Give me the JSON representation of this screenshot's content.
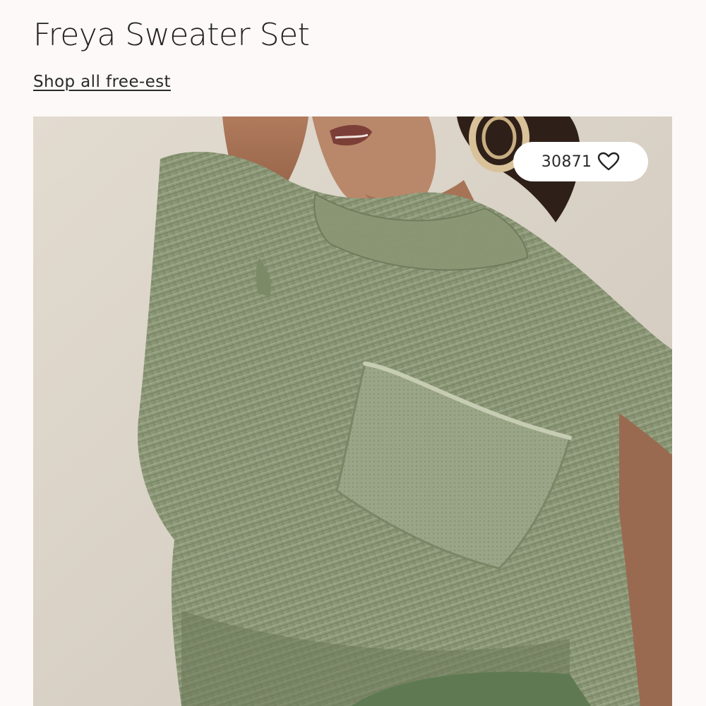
{
  "product": {
    "title": "Freya Sweater Set",
    "shop_link": "Shop all free-est"
  },
  "gallery": {
    "image_icon": "product-photo",
    "likes": {
      "count": "30871",
      "icon": "heart-outline-icon"
    }
  },
  "colors": {
    "page_background": "#fcf9f8",
    "sweater_green": "#8f9c7a",
    "pill_background": "#ffffff"
  }
}
